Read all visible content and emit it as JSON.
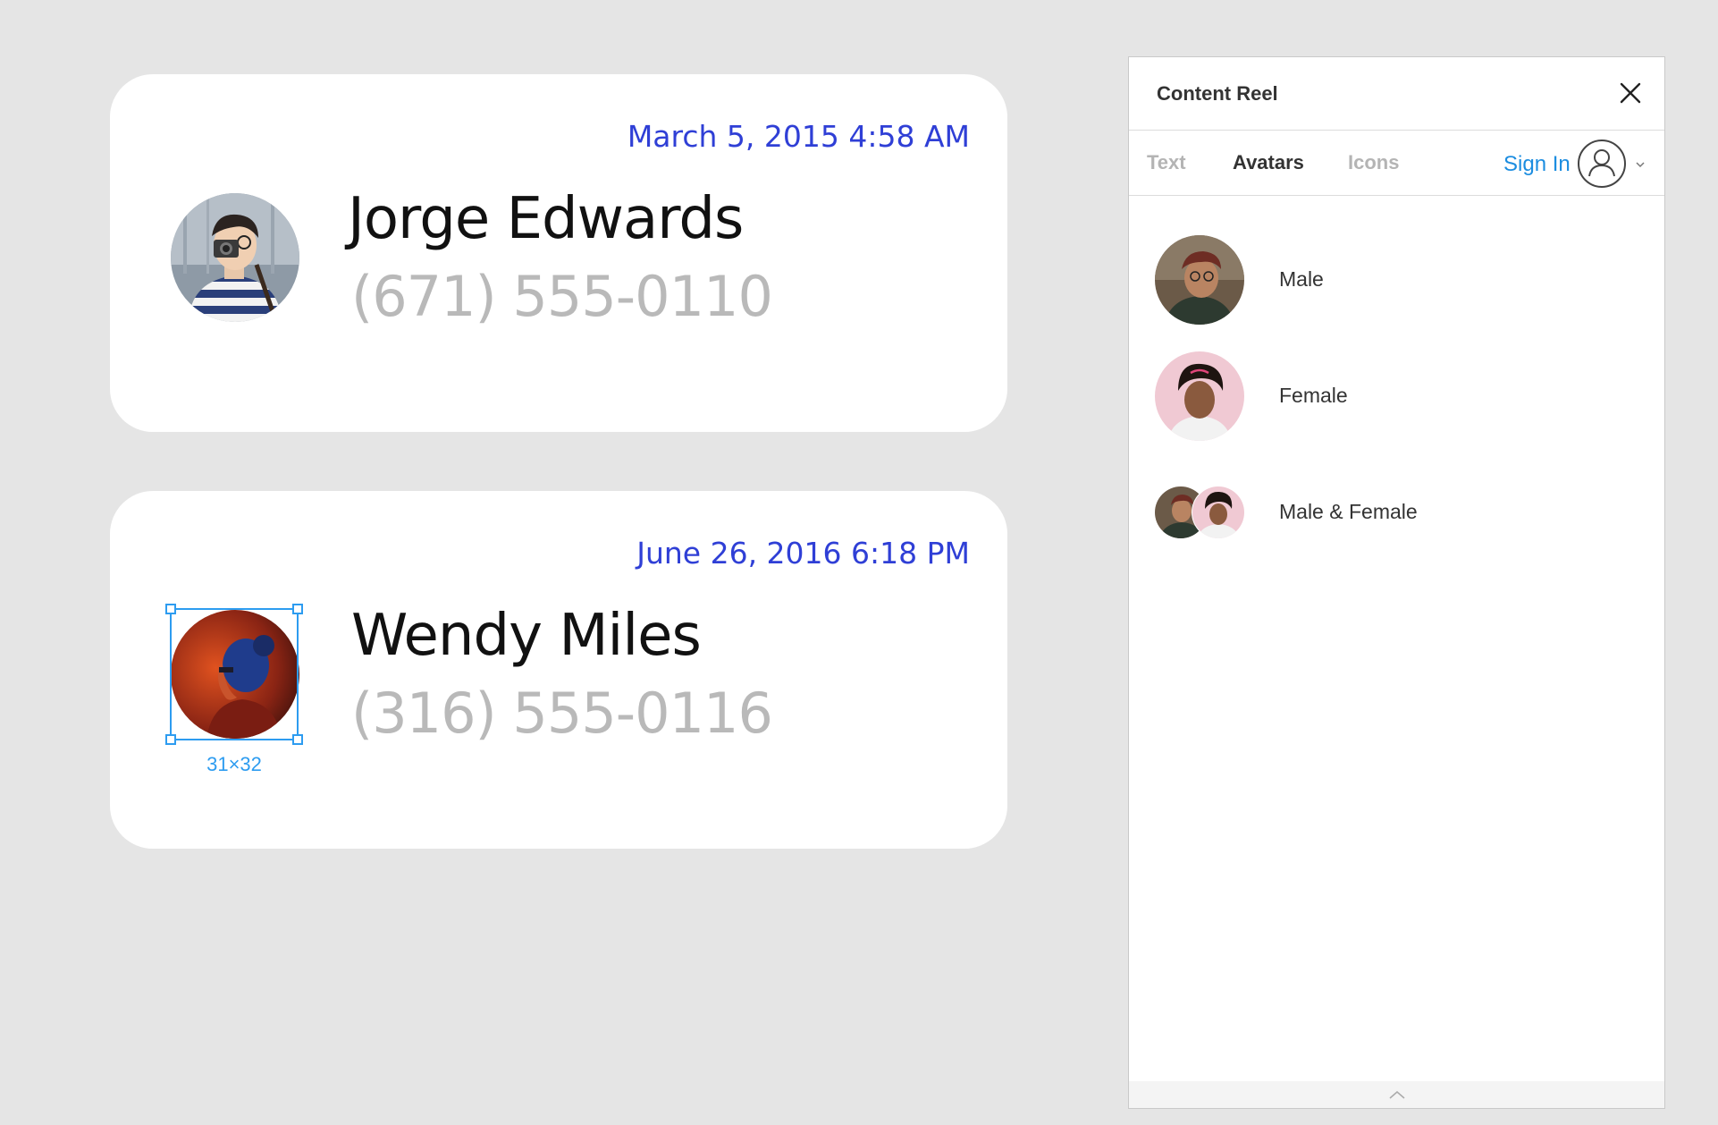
{
  "colors": {
    "canvas": "#e5e5e5",
    "timestamp": "#2f3fd6",
    "name": "#111111",
    "phone": "#b9b9b9",
    "selection": "#2d9cf0",
    "link": "#1c8de0"
  },
  "cards": [
    {
      "timestamp": "March 5, 2015 4:58 AM",
      "name": "Jorge Edwards",
      "phone": "(671) 555-0110",
      "avatar_icon": "male-photographer-avatar"
    },
    {
      "timestamp": "June 26, 2016 6:18 PM",
      "name": "Wendy Miles",
      "phone": "(316) 555-0116",
      "avatar_icon": "female-neon-avatar"
    }
  ],
  "selection": {
    "size_label": "31×32"
  },
  "panel": {
    "title": "Content Reel",
    "close_icon": "close-icon",
    "tabs": [
      {
        "label": "Text",
        "active": false
      },
      {
        "label": "Avatars",
        "active": true
      },
      {
        "label": "Icons",
        "active": false
      }
    ],
    "sign_in": "Sign In",
    "user_icon": "user-circle-icon",
    "items": [
      {
        "label": "Male",
        "icon": "male-avatar"
      },
      {
        "label": "Female",
        "icon": "female-avatar"
      },
      {
        "label": "Male & Female",
        "icon": "male-female-avatar"
      }
    ],
    "footer_icon": "chevron-up-icon"
  }
}
